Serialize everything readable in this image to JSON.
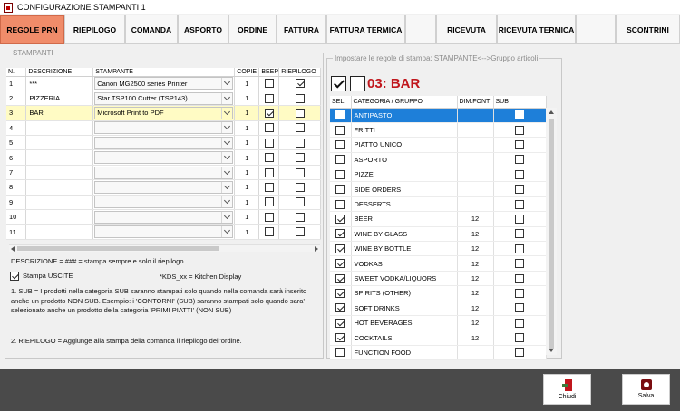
{
  "window": {
    "title": "CONFIGURAZIONE STAMPANTI 1"
  },
  "tabs": [
    {
      "label": "REGOLE PRN",
      "active": true
    },
    {
      "label": "RIEPILOGO",
      "active": false
    },
    {
      "label": "COMANDA",
      "active": false
    },
    {
      "label": "ASPORTO",
      "active": false
    },
    {
      "label": "ORDINE",
      "active": false
    },
    {
      "label": "FATTURA",
      "active": false
    },
    {
      "label": "FATTURA TERMICA",
      "active": false
    },
    {
      "label": "",
      "active": false
    },
    {
      "label": "RICEVUTA",
      "active": false
    },
    {
      "label": "RICEVUTA TERMICA",
      "active": false
    },
    {
      "label": "",
      "active": false
    },
    {
      "label": "SCONTRINI",
      "active": false
    }
  ],
  "printers": {
    "legend": "STAMPANTI",
    "columns": {
      "n": "N.",
      "descrizione": "DESCRIZIONE",
      "stampante": "STAMPANTE",
      "copie": "COPIE",
      "beep": "BEEP",
      "riepilogo": "RIEPILOGO"
    },
    "rows": [
      {
        "n": "1",
        "descrizione": "***",
        "stampante": "Canon MG2500 series Printer",
        "copie": "1",
        "beep": false,
        "riepilogo": true
      },
      {
        "n": "2",
        "descrizione": "PIZZERIA",
        "stampante": "Star TSP100 Cutter (TSP143)",
        "copie": "1",
        "beep": false,
        "riepilogo": false
      },
      {
        "n": "3",
        "descrizione": "BAR",
        "stampante": "Microsoft Print to PDF",
        "copie": "1",
        "beep": true,
        "riepilogo": false,
        "selected": true
      },
      {
        "n": "4",
        "descrizione": "",
        "stampante": "",
        "copie": "1",
        "beep": false,
        "riepilogo": false
      },
      {
        "n": "5",
        "descrizione": "",
        "stampante": "",
        "copie": "1",
        "beep": false,
        "riepilogo": false
      },
      {
        "n": "6",
        "descrizione": "",
        "stampante": "",
        "copie": "1",
        "beep": false,
        "riepilogo": false
      },
      {
        "n": "7",
        "descrizione": "",
        "stampante": "",
        "copie": "1",
        "beep": false,
        "riepilogo": false
      },
      {
        "n": "8",
        "descrizione": "",
        "stampante": "",
        "copie": "1",
        "beep": false,
        "riepilogo": false
      },
      {
        "n": "9",
        "descrizione": "",
        "stampante": "",
        "copie": "1",
        "beep": false,
        "riepilogo": false
      },
      {
        "n": "10",
        "descrizione": "",
        "stampante": "",
        "copie": "1",
        "beep": false,
        "riepilogo": false
      },
      {
        "n": "11",
        "descrizione": "",
        "stampante": "",
        "copie": "1",
        "beep": false,
        "riepilogo": false
      }
    ]
  },
  "notes": {
    "descrizione_hint": "DESCRIZIONE = ###   = stampa sempre e solo il riepilogo",
    "stampa_uscite_label": "Stampa USCITE",
    "stampa_uscite_checked": true,
    "kds_hint": "*KDS_xx = Kitchen Display",
    "sub_note": "1. SUB = I prodotti nella categoria SUB saranno stampati solo quando nella comanda sarà inserito anche un prodotto NON SUB. Esempio: i 'CONTORNI' (SUB) saranno stampati solo quando sara' selezionato anche un prodotto della categoria 'PRIMI PIATTI' (NON SUB)",
    "riepilogo_note": "2. RIEPILOGO = Aggiunge alla stampa della comanda il riepilogo dell'ordine."
  },
  "rules": {
    "legend": "Impostare le regole di stampa:  STAMPANTE<-->Gruppo articoli",
    "select_all_checked": true,
    "select_none_checked": false,
    "printer_title": "03: BAR",
    "columns": {
      "sel": "SEL.",
      "categoria": "CATEGORIA / GRUPPO",
      "dimfont": "DIM.FONT",
      "sub": "SUB"
    },
    "rows": [
      {
        "sel": false,
        "categoria": "ANTIPASTO",
        "dimfont": "",
        "sub": false,
        "highlight": true
      },
      {
        "sel": false,
        "categoria": "FRITTI",
        "dimfont": "",
        "sub": false
      },
      {
        "sel": false,
        "categoria": "PIATTO UNICO",
        "dimfont": "",
        "sub": false
      },
      {
        "sel": false,
        "categoria": "ASPORTO",
        "dimfont": "",
        "sub": false
      },
      {
        "sel": false,
        "categoria": "PIZZE",
        "dimfont": "",
        "sub": false
      },
      {
        "sel": false,
        "categoria": "SIDE ORDERS",
        "dimfont": "",
        "sub": false
      },
      {
        "sel": false,
        "categoria": "DESSERTS",
        "dimfont": "",
        "sub": false
      },
      {
        "sel": true,
        "categoria": "BEER",
        "dimfont": "12",
        "sub": false
      },
      {
        "sel": true,
        "categoria": "WINE BY GLASS",
        "dimfont": "12",
        "sub": false
      },
      {
        "sel": true,
        "categoria": "WINE BY BOTTLE",
        "dimfont": "12",
        "sub": false
      },
      {
        "sel": true,
        "categoria": "VODKAS",
        "dimfont": "12",
        "sub": false
      },
      {
        "sel": true,
        "categoria": "SWEET VODKA/LIQUORS",
        "dimfont": "12",
        "sub": false
      },
      {
        "sel": true,
        "categoria": "SPIRITS (OTHER)",
        "dimfont": "12",
        "sub": false
      },
      {
        "sel": true,
        "categoria": "SOFT DRINKS",
        "dimfont": "12",
        "sub": false
      },
      {
        "sel": true,
        "categoria": "HOT BEVERAGES",
        "dimfont": "12",
        "sub": false
      },
      {
        "sel": true,
        "categoria": "COCKTAILS",
        "dimfont": "12",
        "sub": false
      },
      {
        "sel": false,
        "categoria": "FUNCTION FOOD",
        "dimfont": "",
        "sub": false
      }
    ]
  },
  "footer": {
    "close_label": "Chiudi",
    "save_label": "Salva"
  }
}
